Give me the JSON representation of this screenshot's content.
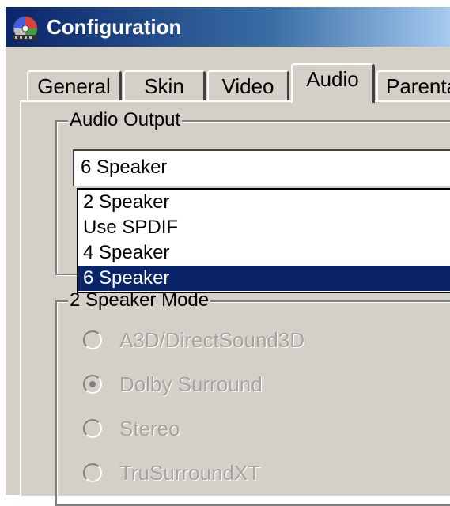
{
  "window": {
    "title": "Configuration"
  },
  "tabs": [
    {
      "label": "General",
      "active": false
    },
    {
      "label": "Skin",
      "active": false
    },
    {
      "label": "Video",
      "active": false
    },
    {
      "label": "Audio",
      "active": true
    },
    {
      "label": "Parenta",
      "active": false
    }
  ],
  "audio_output": {
    "group_label": "Audio Output",
    "selected": "6 Speaker",
    "options": [
      "2 Speaker",
      "Use SPDIF",
      "4 Speaker",
      "6 Speaker"
    ]
  },
  "speaker_mode": {
    "group_label": "2 Speaker Mode",
    "enabled": false,
    "options": [
      {
        "label": "A3D/DirectSound3D",
        "checked": false
      },
      {
        "label": "Dolby Surround",
        "checked": true
      },
      {
        "label": "Stereo",
        "checked": false
      },
      {
        "label": "TruSurroundXT",
        "checked": false
      }
    ]
  },
  "colors": {
    "titlebar": "#0a246a",
    "selection": "#0a246a",
    "face": "#d4d0c8"
  }
}
